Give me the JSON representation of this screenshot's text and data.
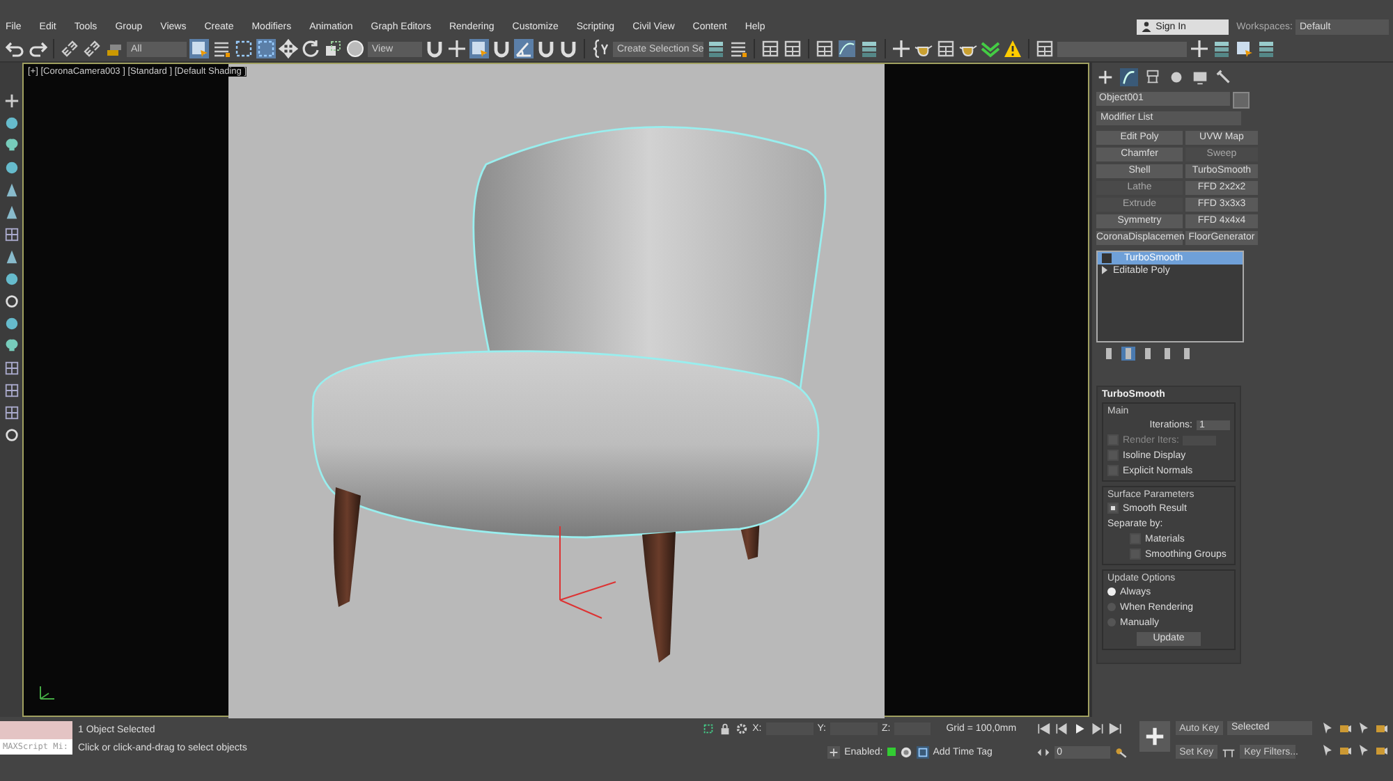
{
  "menu": [
    "File",
    "Edit",
    "Tools",
    "Group",
    "Views",
    "Create",
    "Modifiers",
    "Animation",
    "Graph Editors",
    "Rendering",
    "Customize",
    "Scripting",
    "Civil View",
    "Content",
    "Help"
  ],
  "account": {
    "sign_in": "Sign In",
    "workspaces_label": "Workspaces:",
    "workspace": "Default"
  },
  "toolbar": {
    "selection_filter": "All",
    "reference_coord": "View",
    "selection_set": "Create Selection Se"
  },
  "viewport": {
    "label": "[+] [CoronaCamera003 ] [Standard ] [Default Shading ]"
  },
  "command_panel": {
    "tabs": [
      {
        "kind": "create",
        "selected": false
      },
      {
        "kind": "modify",
        "selected": true
      },
      {
        "kind": "hierarchy",
        "selected": false
      },
      {
        "kind": "motion",
        "selected": false
      },
      {
        "kind": "display",
        "selected": false
      },
      {
        "kind": "utilities",
        "selected": false
      }
    ],
    "object_name": "Object001",
    "modifier_list": "Modifier List",
    "modifier_buttons": [
      {
        "label": "Edit Poly",
        "disabled": false
      },
      {
        "label": "UVW Map",
        "disabled": false
      },
      {
        "label": "Chamfer",
        "disabled": false
      },
      {
        "label": "Sweep",
        "disabled": true
      },
      {
        "label": "Shell",
        "disabled": false
      },
      {
        "label": "TurboSmooth",
        "disabled": false
      },
      {
        "label": "Lathe",
        "disabled": true
      },
      {
        "label": "FFD 2x2x2",
        "disabled": false
      },
      {
        "label": "Extrude",
        "disabled": true
      },
      {
        "label": "FFD 3x3x3",
        "disabled": false
      },
      {
        "label": "Symmetry",
        "disabled": false
      },
      {
        "label": "FFD 4x4x4",
        "disabled": false
      },
      {
        "label": "CoronaDisplacemen",
        "disabled": false
      },
      {
        "label": "FloorGenerator",
        "disabled": false
      }
    ],
    "stack": [
      {
        "label": "TurboSmooth",
        "kind": "modifier",
        "selected": true
      },
      {
        "label": "Editable Poly",
        "kind": "object",
        "selected": false
      }
    ],
    "rollout": {
      "title": "TurboSmooth",
      "groups": [
        {
          "title": "Main",
          "items": [
            {
              "kind": "spinner",
              "label": "Iterations:",
              "value": "1"
            },
            {
              "kind": "checkbox_spinner",
              "label": "Render Iters:",
              "checked": false
            },
            {
              "kind": "checkbox",
              "label": "Isoline Display",
              "checked": false
            },
            {
              "kind": "checkbox",
              "label": "Explicit Normals",
              "checked": false
            }
          ]
        },
        {
          "title": "Surface Parameters",
          "items": [
            {
              "kind": "checkbox",
              "label": "Smooth Result",
              "checked": true
            },
            {
              "kind": "label",
              "label": "Separate by:"
            },
            {
              "kind": "sub_checkbox",
              "label": "Materials",
              "checked": false
            },
            {
              "kind": "sub_checkbox",
              "label": "Smoothing Groups",
              "checked": false
            }
          ]
        },
        {
          "title": "Update Options",
          "items": [
            {
              "kind": "radio",
              "label": "Always",
              "selected": true
            },
            {
              "kind": "radio",
              "label": "When Rendering",
              "selected": false
            },
            {
              "kind": "radio",
              "label": "Manually",
              "selected": false
            },
            {
              "kind": "button",
              "label": "Update"
            }
          ]
        }
      ]
    }
  },
  "status": {
    "listener_placeholder": "MAXScript Mi:",
    "selection": "1 Object Selected",
    "prompt": "Click or click-and-drag to select objects"
  },
  "coordinates": {
    "x_label": "X:",
    "y_label": "Y:",
    "z_label": "Z:",
    "grid": "Grid = 100,0mm"
  },
  "time_tag": {
    "enabled_label": "Enabled:",
    "enabled": true,
    "add_label": "Add Time Tag"
  },
  "animation": {
    "frame": "0",
    "auto_key": "Auto Key",
    "key_mode": "Selected",
    "set_key": "Set Key",
    "key_filters": "Key Filters..."
  }
}
